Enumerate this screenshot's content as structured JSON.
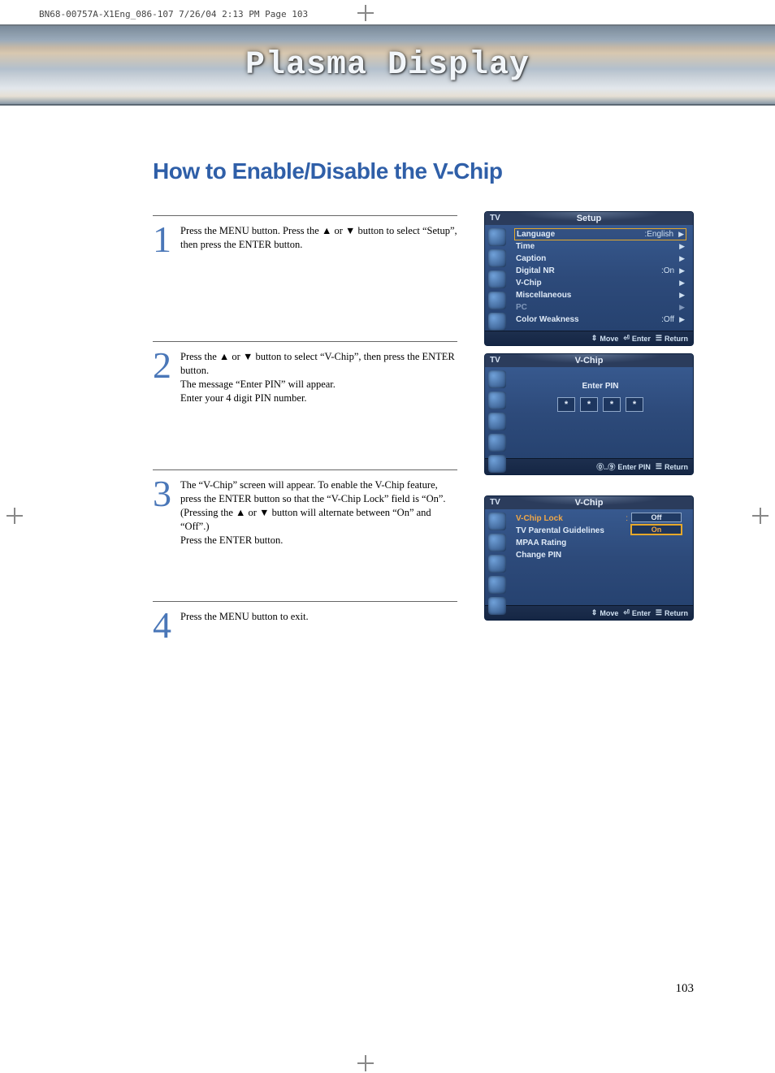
{
  "crop_info": "BN68-00757A-X1Eng_086-107  7/26/04  2:13 PM  Page 103",
  "banner_title": "Plasma Display",
  "page_title": "How to Enable/Disable the V-Chip",
  "steps": [
    {
      "num": "1",
      "text": "Press the MENU button. Press the ▲ or ▼ button to select “Setup”, then press the ENTER button."
    },
    {
      "num": "2",
      "text": "Press the ▲ or ▼ button to select “V-Chip”, then press the ENTER button.\nThe message “Enter PIN” will appear.\nEnter your 4 digit PIN number."
    },
    {
      "num": "3",
      "text": "The “V-Chip” screen will appear. To enable the V-Chip feature, press the ENTER button so that the “V-Chip Lock” field is “On”. (Pressing the ▲ or ▼ button will alternate between “On” and “Off”.)\nPress the ENTER button."
    },
    {
      "num": "4",
      "text": "Press the MENU button to exit."
    }
  ],
  "osd1": {
    "tv": "TV",
    "title": "Setup",
    "rows": [
      {
        "label": "Language",
        "val": "English",
        "sel": true
      },
      {
        "label": "Time"
      },
      {
        "label": "Caption"
      },
      {
        "label": "Digital NR",
        "val": "On"
      },
      {
        "label": "V-Chip"
      },
      {
        "label": "Miscellaneous"
      },
      {
        "label": "PC",
        "dim": true
      },
      {
        "label": "Color Weakness",
        "val": "Off"
      }
    ],
    "foot": {
      "move": "Move",
      "enter": "Enter",
      "ret": "Return"
    }
  },
  "osd2": {
    "tv": "TV",
    "title": "V-Chip",
    "enter_pin": "Enter PIN",
    "mask": "*",
    "foot": {
      "p1": "Enter PIN",
      "ret": "Return"
    }
  },
  "osd3": {
    "tv": "TV",
    "title": "V-Chip",
    "rows": [
      {
        "label": "V-Chip Lock",
        "orange": true,
        "select": true
      },
      {
        "label": "TV Parental Guidelines"
      },
      {
        "label": "MPAA Rating"
      },
      {
        "label": "Change PIN"
      }
    ],
    "opt_off": "Off",
    "opt_on": "On",
    "foot": {
      "move": "Move",
      "enter": "Enter",
      "ret": "Return"
    }
  },
  "page_number": "103"
}
